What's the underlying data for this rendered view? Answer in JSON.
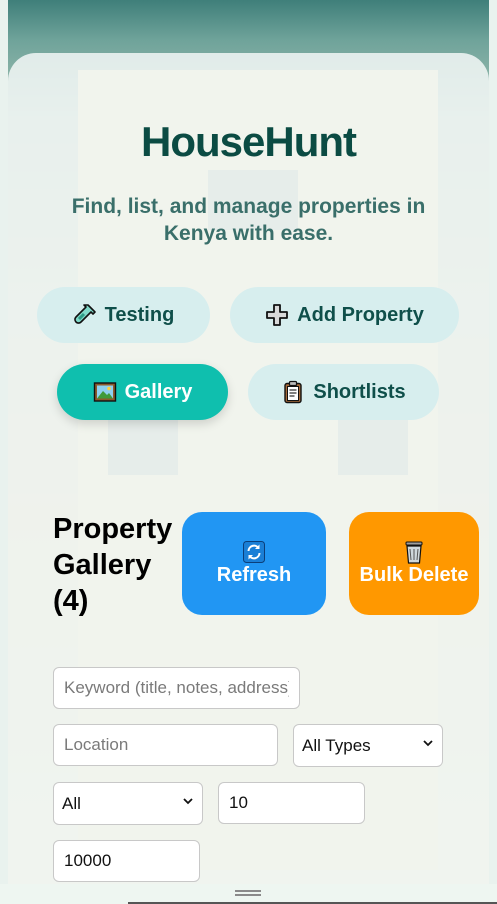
{
  "app": {
    "title": "HouseHunt",
    "subtitle": "Find, list, and manage properties in Kenya with ease."
  },
  "nav": {
    "testing_label": "Testing",
    "add_property_label": "Add Property",
    "gallery_label": "Gallery",
    "shortlists_label": "Shortlists",
    "active": "Gallery"
  },
  "gallery": {
    "heading": "Property Gallery (4)",
    "refresh_label": "Refresh",
    "bulk_delete_label": "Bulk Delete"
  },
  "filters": {
    "keyword_placeholder": "Keyword (title, notes, address)",
    "location_placeholder": "Location",
    "type_selected": "All Types",
    "bedrooms_selected": "All",
    "min_value": "10",
    "max_value": "10000"
  },
  "colors": {
    "brand": "#0b4b43",
    "active_tab": "#0fbfae",
    "refresh": "#2196f3",
    "bulk_delete": "#ff9800"
  },
  "icons": {
    "testing": "test-tube-icon",
    "add_property": "plus-icon",
    "gallery": "picture-icon",
    "shortlists": "clipboard-icon",
    "refresh": "refresh-icon",
    "bulk_delete": "trash-icon"
  }
}
